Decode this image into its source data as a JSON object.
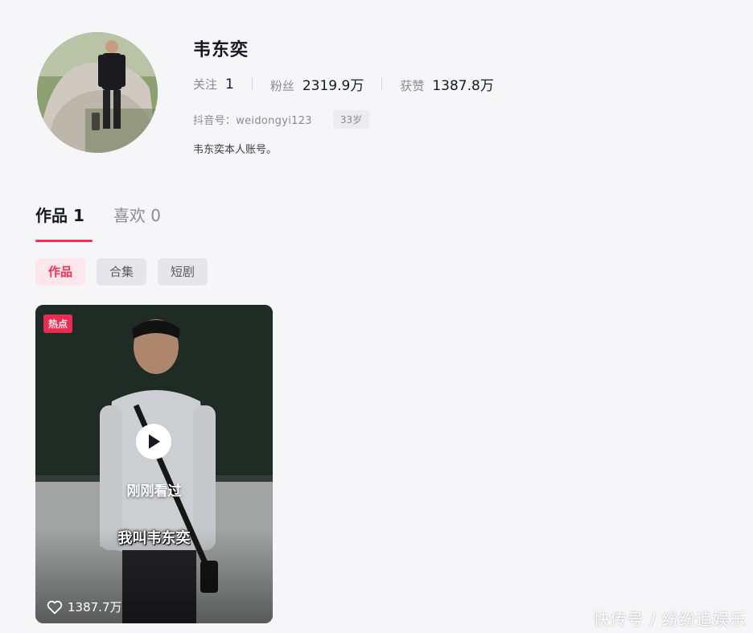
{
  "profile": {
    "username": "韦东奕",
    "stats": [
      {
        "label": "关注",
        "value": "1"
      },
      {
        "label": "粉丝",
        "value": "2319.9万"
      },
      {
        "label": "获赞",
        "value": "1387.8万"
      }
    ],
    "account_id": "抖音号：weidongyi123",
    "age": "33岁",
    "bio": "韦东奕本人账号。"
  },
  "tabs": [
    {
      "label": "作品 1",
      "active": true
    },
    {
      "label": "喜欢 0",
      "active": false
    }
  ],
  "filters": [
    {
      "label": "作品",
      "active": true
    },
    {
      "label": "合集",
      "active": false
    },
    {
      "label": "短剧",
      "active": false
    }
  ],
  "video": {
    "badge": "热点",
    "watched_label": "刚刚看过",
    "caption": "我叫韦东奕",
    "likes": "1387.7万"
  },
  "watermark": "快传号 / 纷纷追娱乐",
  "colors": {
    "accent": "#fe2c55",
    "background": "#f6f6f8"
  },
  "icons": {
    "play": "play-icon",
    "heart": "heart-outline-icon"
  }
}
